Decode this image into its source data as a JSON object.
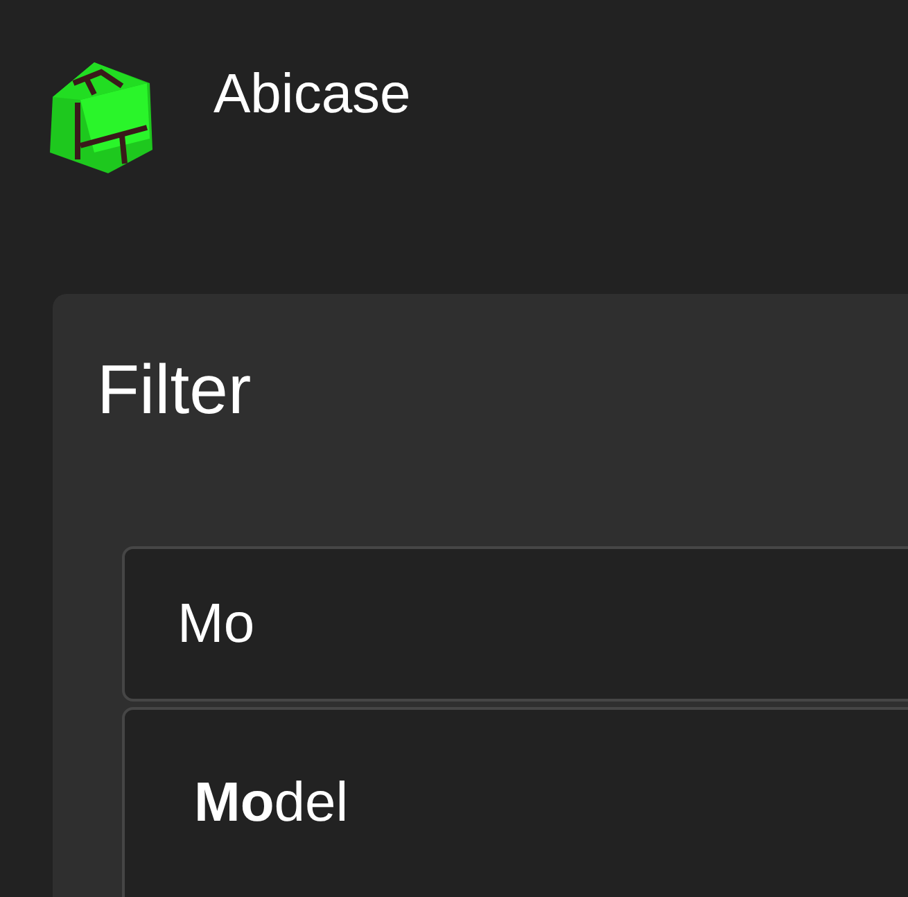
{
  "app": {
    "title": "Abicase"
  },
  "filter": {
    "title": "Filter",
    "search": {
      "value": "Mo"
    },
    "suggestions": [
      {
        "label": "**Mo**del"
      }
    ]
  }
}
